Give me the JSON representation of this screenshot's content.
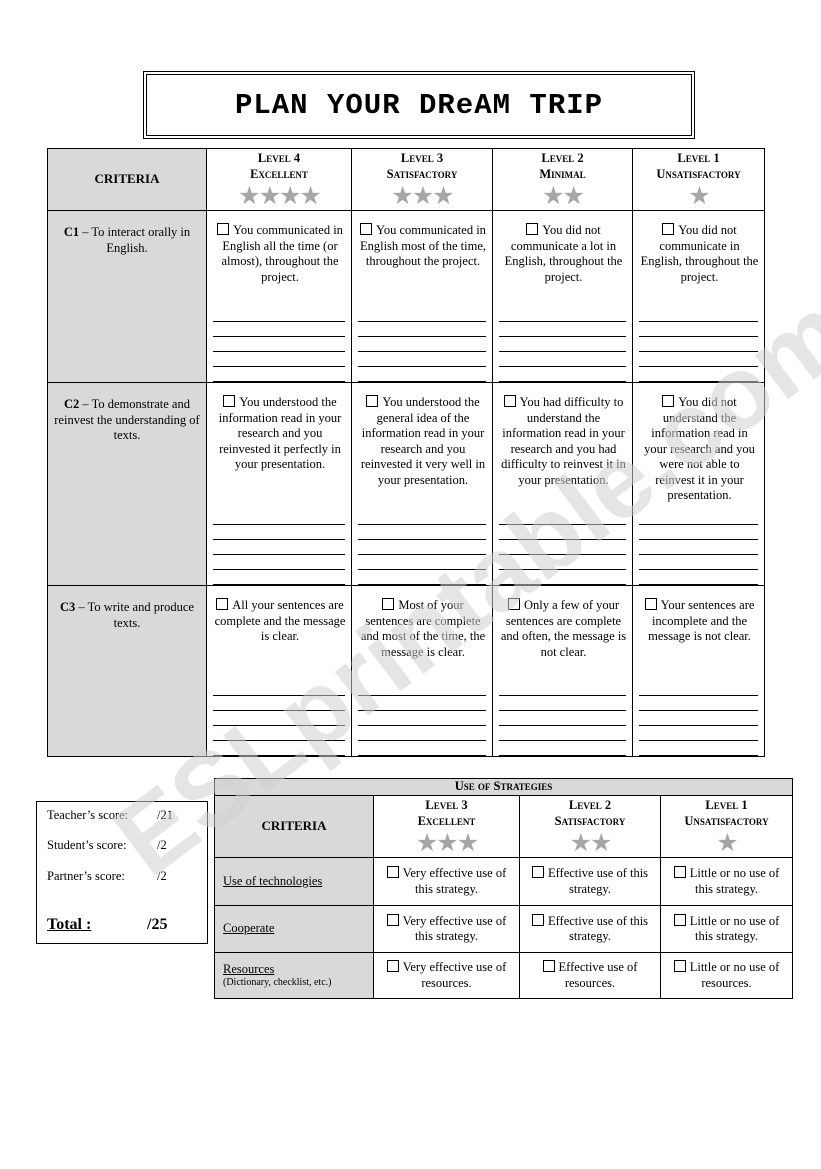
{
  "title": "PLAN YOUR DReAM TRIP",
  "watermark": "ESLprintable.com",
  "rubric": {
    "criteria_header": "CRITERIA",
    "levels": [
      {
        "level": "Level 4",
        "name": "Excellent",
        "stars": "★★★★"
      },
      {
        "level": "Level 3",
        "name": "Satisfactory",
        "stars": "★★★"
      },
      {
        "level": "Level 2",
        "name": "Minimal",
        "stars": "★★"
      },
      {
        "level": "Level 1",
        "name": "Unsatisfactory",
        "stars": "★"
      }
    ],
    "rows": [
      {
        "code": "C1",
        "criterion": " – To interact orally in English.",
        "descriptors": [
          "You communicated in English all the time (or almost), throughout the project.",
          "You communicated in English most of the time, throughout the project.",
          "You did not communicate a lot in English, throughout the project.",
          "You did not communicate in English, throughout the project."
        ]
      },
      {
        "code": "C2",
        "criterion": " – To demonstrate and reinvest the understanding of texts.",
        "descriptors": [
          "You understood the information read in your research and you reinvested it perfectly in your presentation.",
          "You understood the general idea of the information read in your research and you reinvested it very well in your presentation.",
          "You had difficulty to understand the information read in your research and you had difficulty to reinvest it in your presentation.",
          "You did not understand the information read in your research and you were not able to reinvest it in your presentation."
        ]
      },
      {
        "code": "C3",
        "criterion": " – To write and produce texts.",
        "descriptors": [
          "All your sentences are complete and the message is clear.",
          "Most of your sentences are complete and most of the time, the message is clear.",
          "Only a few of your sentences are complete and often, the message is not clear.",
          "Your sentences are incomplete and the message is not clear."
        ]
      }
    ]
  },
  "scores": {
    "teacher_label": "Teacher’s score:",
    "teacher_value": "/21",
    "student_label": "Student’s score:",
    "student_value": "/2",
    "partner_label": "Partner’s score:",
    "partner_value": "/2",
    "total_label": "Total :",
    "total_value": "/25"
  },
  "strategies": {
    "title": "Use of Strategies",
    "criteria_header": "CRITERIA",
    "levels": [
      {
        "level": "Level 3",
        "name": "Excellent",
        "stars": "★★★"
      },
      {
        "level": "Level 2",
        "name": "Satisfactory",
        "stars": "★★"
      },
      {
        "level": "Level 1",
        "name": "Unsatisfactory",
        "stars": "★"
      }
    ],
    "rows": [
      {
        "criterion": "Use of technologies",
        "note": "",
        "descriptors": [
          "Very effective use of this strategy.",
          "Effective use of this strategy.",
          "Little or no use of this strategy."
        ]
      },
      {
        "criterion": "Cooperate",
        "note": "",
        "descriptors": [
          "Very effective use of this strategy.",
          "Effective use of this strategy.",
          "Little or no use of this strategy."
        ]
      },
      {
        "criterion": "Resources",
        "note": "(Dictionary, checklist, etc.)",
        "descriptors": [
          "Very effective use of resources.",
          "Effective use of resources.",
          "Little or no use of resources."
        ]
      }
    ]
  }
}
